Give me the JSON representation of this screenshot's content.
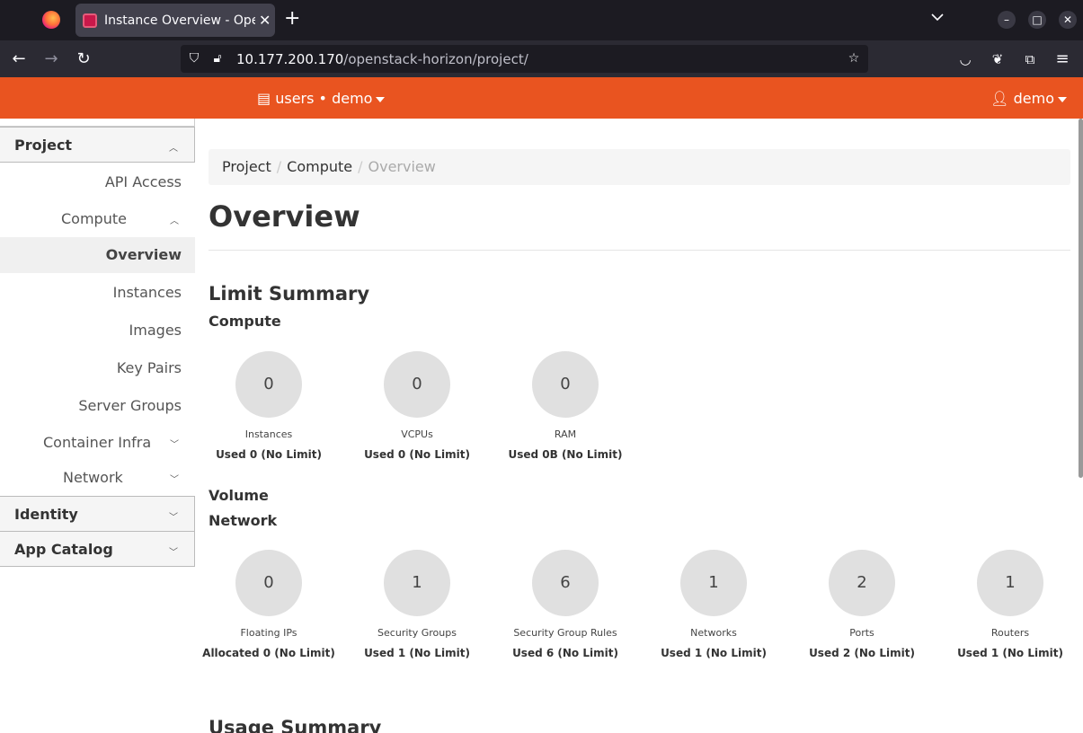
{
  "browser": {
    "tab_title": "Instance Overview - OpenStack Dashboard",
    "new_tab_icon": "+",
    "url_host": "10.177.200.170",
    "url_path": "/openstack-horizon/project/"
  },
  "header": {
    "project_selector": "users • demo",
    "user_menu": "demo"
  },
  "sidebar": {
    "project": "Project",
    "api_access": "API Access",
    "compute": "Compute",
    "overview": "Overview",
    "instances": "Instances",
    "images": "Images",
    "key_pairs": "Key Pairs",
    "server_groups": "Server Groups",
    "container_infra": "Container Infra",
    "network": "Network",
    "identity": "Identity",
    "app_catalog": "App Catalog"
  },
  "breadcrumb": {
    "project": "Project",
    "compute": "Compute",
    "current": "Overview"
  },
  "main": {
    "title": "Overview",
    "limit_summary": "Limit Summary",
    "compute_heading": "Compute",
    "volume_heading": "Volume",
    "network_heading": "Network",
    "usage_summary": "Usage Summary",
    "compute_limits": [
      {
        "value": "0",
        "name": "Instances",
        "used": "Used 0 (No Limit)"
      },
      {
        "value": "0",
        "name": "VCPUs",
        "used": "Used 0 (No Limit)"
      },
      {
        "value": "0",
        "name": "RAM",
        "used": "Used 0B (No Limit)"
      }
    ],
    "network_limits": [
      {
        "value": "0",
        "name": "Floating IPs",
        "used": "Allocated 0 (No Limit)"
      },
      {
        "value": "1",
        "name": "Security Groups",
        "used": "Used 1 (No Limit)"
      },
      {
        "value": "6",
        "name": "Security Group Rules",
        "used": "Used 6 (No Limit)"
      },
      {
        "value": "1",
        "name": "Networks",
        "used": "Used 1 (No Limit)"
      },
      {
        "value": "2",
        "name": "Ports",
        "used": "Used 2 (No Limit)"
      },
      {
        "value": "1",
        "name": "Routers",
        "used": "Used 1 (No Limit)"
      }
    ]
  },
  "colors": {
    "header_bg": "#e95420",
    "pie_bg": "#e0e0e0"
  }
}
